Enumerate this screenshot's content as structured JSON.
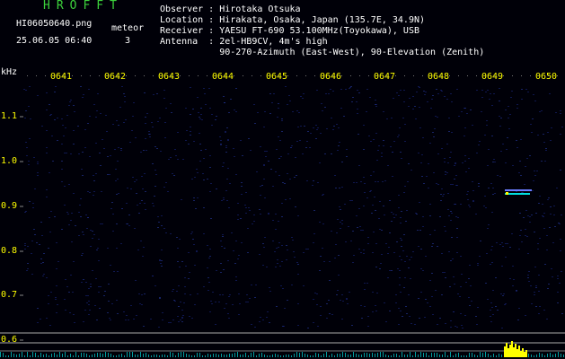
{
  "header": {
    "title": "HROFFT",
    "filename": "HI06050640.png",
    "timestamp": "25.06.05 06:40",
    "meteor_label": "meteor",
    "meteor_count": "3"
  },
  "station": {
    "observer": "Observer : Hirotaka Otsuka",
    "location": "Location : Hirakata, Osaka, Japan (135.7E, 34.9N)",
    "receiver": "Receiver : YAESU FT-690 53.100MHz(Toyokawa), USB",
    "antenna": "Antenna  : 2el-HB9CV, 4m's high",
    "antenna_detail": "           90-270-Azimuth (East-West), 90-Elevation (Zenith)"
  },
  "axes": {
    "unit": "kHz",
    "x_ticks": [
      "0641",
      "0642",
      "0643",
      "0644",
      "0645",
      "0646",
      "0647",
      "0648",
      "0649",
      "0650"
    ],
    "y_ticks": [
      "1.1",
      "1.0",
      "0.9",
      "0.8",
      "0.7",
      "0.6"
    ]
  },
  "colors": {
    "header_green": "#3cd23c",
    "label_white": "#ffffff",
    "tick_yellow": "#ffff00",
    "background": "#000008",
    "noise_blue": "#1b2a8a",
    "signal_cyan": "#00e0e0",
    "echo_yellow": "#ffff00"
  }
}
